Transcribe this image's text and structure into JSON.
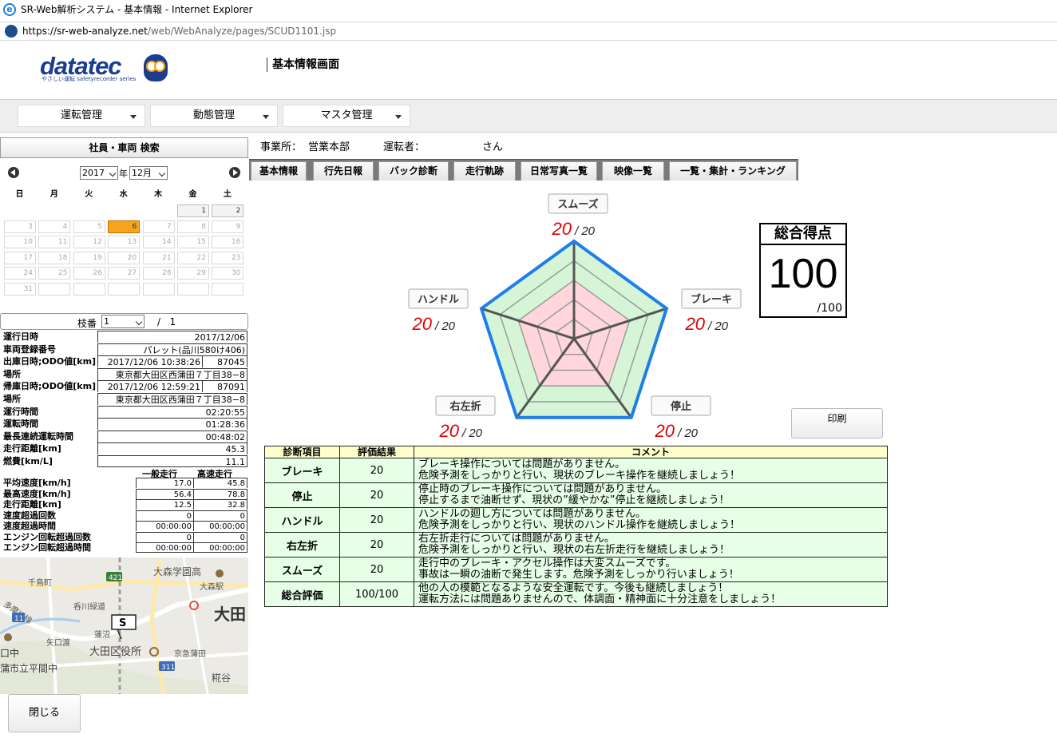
{
  "window": {
    "title": "SR-Web解析システム - 基本情報 - Internet Explorer",
    "url_host": "https://sr-web-analyze.net",
    "url_path": "/web/WebAnalyze/pages/SCUD1101.jsp"
  },
  "brand": {
    "logo_text": "datatec",
    "logo_sub": "やさしい運転 safetyrecorder series",
    "primary_color": "#1b3d8f",
    "accent_color": "#f8a31c"
  },
  "page_title": "基本情報画面",
  "menu": [
    {
      "label": "運転管理"
    },
    {
      "label": "動態管理"
    },
    {
      "label": "マスタ管理"
    }
  ],
  "search_panel": {
    "title": "社員・車両 検索"
  },
  "calendar": {
    "year": "2017",
    "year_suffix": "年",
    "month": "12月",
    "weekdays": [
      "日",
      "月",
      "火",
      "水",
      "木",
      "金",
      "土"
    ],
    "days": [
      [
        "",
        "",
        "",
        "",
        "",
        "1",
        "2"
      ],
      [
        "3",
        "4",
        "5",
        "6",
        "7",
        "8",
        "9"
      ],
      [
        "10",
        "11",
        "12",
        "13",
        "14",
        "15",
        "16"
      ],
      [
        "17",
        "18",
        "19",
        "20",
        "21",
        "22",
        "23"
      ],
      [
        "24",
        "25",
        "26",
        "27",
        "28",
        "29",
        "30"
      ],
      [
        "31",
        "",
        "",
        "",
        "",
        "",
        ""
      ]
    ],
    "selected_day": "6"
  },
  "branch": {
    "label": "枝番",
    "value": "1",
    "total": "/   1"
  },
  "info": {
    "run_date": {
      "label": "運行日時",
      "value": "2017/12/06"
    },
    "plate": {
      "label": "車両登録番号",
      "value": "パレット(品川580け406)"
    },
    "depart": {
      "label": "出庫日時;ODO値[km]",
      "time": "2017/12/06 10:38:26",
      "odo": "87045"
    },
    "depart_place": {
      "label": "場所",
      "value": "東京都大田区西蒲田７丁目38−8"
    },
    "return": {
      "label": "帰庫日時;ODO値[km]",
      "time": "2017/12/06 12:59:21",
      "odo": "87091"
    },
    "return_place": {
      "label": "場所",
      "value": "東京都大田区西蒲田７丁目38−8"
    },
    "run_time": {
      "label": "運行時間",
      "value": "02:20:55"
    },
    "drive_time": {
      "label": "運転時間",
      "value": "01:28:36"
    },
    "max_cont": {
      "label": "最長連続運転時間",
      "value": "00:48:02"
    },
    "distance": {
      "label": "走行距離[km]",
      "value": "45.3"
    },
    "fuel": {
      "label": "燃費[km/L]",
      "value": "11.1"
    }
  },
  "speed": {
    "col_general": "一般走行",
    "col_highway": "高速走行",
    "rows": [
      {
        "label": "平均速度[km/h]",
        "general": "17.0",
        "highway": "45.8"
      },
      {
        "label": "最高速度[km/h]",
        "general": "56.4",
        "highway": "78.8"
      },
      {
        "label": "走行距離[km]",
        "general": "12.5",
        "highway": "32.8"
      },
      {
        "label": "速度超過回数",
        "general": "0",
        "highway": "0"
      },
      {
        "label": "速度超過時間",
        "general": "00:00:00",
        "highway": "00:00:00"
      },
      {
        "label": "エンジン回転超過回数",
        "general": "0",
        "highway": "0"
      },
      {
        "label": "エンジン回転超過時間",
        "general": "00:00:00",
        "highway": "00:00:00"
      }
    ]
  },
  "map": {
    "labels": [
      "大森学園高",
      "千鳥町",
      "大森駅",
      "大田",
      "呑川緑道",
      "矢口渡",
      "蓮沼",
      "大田区役所",
      "京急蒲田",
      "糀谷",
      "口中",
      "蒲市立平間中",
      "多摩川線"
    ],
    "road_numbers": [
      "421",
      "11",
      "311"
    ],
    "marker": "S"
  },
  "buttons": {
    "close": "閉じる",
    "print": "印刷"
  },
  "header_info": {
    "office_label": "事業所：",
    "office": "営業本部",
    "driver_label": "運転者：",
    "driver_suffix": "さん"
  },
  "tabs": [
    {
      "label": "基本情報"
    },
    {
      "label": "行先日報"
    },
    {
      "label": "バック診断"
    },
    {
      "label": "走行軌跡"
    },
    {
      "label": "日常写真一覧"
    },
    {
      "label": "映像一覧"
    },
    {
      "label": "一覧・集計・ランキング"
    }
  ],
  "chart_data": {
    "type": "radar",
    "axes": [
      "スムーズ",
      "ブレーキ",
      "停止",
      "右左折",
      "ハンドル"
    ],
    "values": [
      20,
      20,
      20,
      20,
      20
    ],
    "max": 20,
    "score_label": "/ 20",
    "series_color": "#1f7fe8"
  },
  "total_score": {
    "title": "総合得点",
    "value": "100",
    "max": "/100"
  },
  "diagnosis": {
    "headers": [
      "診断項目",
      "評価結果",
      "コメント"
    ],
    "rows": [
      {
        "item": "ブレーキ",
        "result": "20",
        "comment1": "ブレーキ操作については問題がありません。",
        "comment2": "危険予測をしっかりと行い、現状のブレーキ操作を継続しましょう！"
      },
      {
        "item": "停止",
        "result": "20",
        "comment1": "停止時のブレーキ操作については問題がありません。",
        "comment2": "停止するまで油断せず、現状の”緩やかな”停止を継続しましょう！"
      },
      {
        "item": "ハンドル",
        "result": "20",
        "comment1": "ハンドルの廻し方については問題がありません。",
        "comment2": "危険予測をしっかりと行い、現状のハンドル操作を継続しましょう！"
      },
      {
        "item": "右左折",
        "result": "20",
        "comment1": "右左折走行については問題がありません。",
        "comment2": "危険予測をしっかりと行い、現状の右左折走行を継続しましょう！"
      },
      {
        "item": "スムーズ",
        "result": "20",
        "comment1": "走行中のブレーキ・アクセル操作は大変スムーズです。",
        "comment2": "事故は一瞬の油断で発生します。危険予測をしっかり行いましょう！"
      },
      {
        "item": "総合評価",
        "result": "100/100",
        "comment1": "他の人の模範となるような安全運転です。今後も継続しましょう！",
        "comment2": "運転方法には問題ありませんので、体調面・精神面に十分注意をしましょう！"
      }
    ]
  }
}
